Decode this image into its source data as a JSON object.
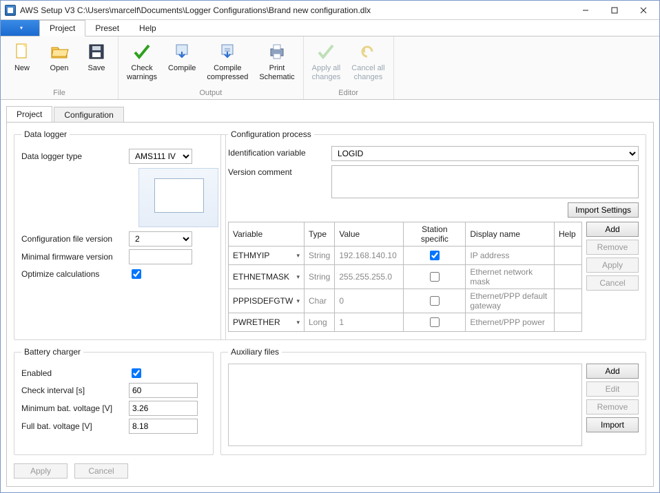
{
  "window": {
    "title": "AWS Setup V3 C:\\Users\\marcelf\\Documents\\Logger Configurations\\Brand new configuration.dlx"
  },
  "menu": {
    "project": "Project",
    "preset": "Preset",
    "help": "Help"
  },
  "ribbon": {
    "file": {
      "label": "File",
      "new": "New",
      "open": "Open",
      "save": "Save"
    },
    "output": {
      "label": "Output",
      "check": "Check\nwarnings",
      "compile": "Compile",
      "compilecomp": "Compile\ncompressed",
      "print": "Print\nSchematic"
    },
    "editor": {
      "label": "Editor",
      "applyall": "Apply all\nchanges",
      "cancelall": "Cancel all\nchanges"
    }
  },
  "page_tabs": {
    "project": "Project",
    "configuration": "Configuration"
  },
  "data_logger": {
    "legend": "Data logger",
    "type_label": "Data logger type",
    "type_value": "AMS111 IV",
    "cfgver_label": "Configuration file version",
    "cfgver_value": "2",
    "minfw_label": "Minimal firmware version",
    "minfw_value": "",
    "optimize_label": "Optimize calculations",
    "optimize_checked": true
  },
  "config_process": {
    "legend": "Configuration process",
    "idvar_label": "Identification variable",
    "idvar_value": "LOGID",
    "vercomment_label": "Version comment",
    "vercomment_value": "",
    "import_settings": "Import Settings",
    "columns": {
      "variable": "Variable",
      "type": "Type",
      "value": "Value",
      "station": "Station specific",
      "display": "Display name",
      "help": "Help"
    },
    "rows": [
      {
        "variable": "ETHMYIP",
        "type": "String",
        "value": "192.168.140.10",
        "station": true,
        "display": "IP address",
        "help": ""
      },
      {
        "variable": "ETHNETMASK",
        "type": "String",
        "value": "255.255.255.0",
        "station": false,
        "display": "Ethernet network mask",
        "help": ""
      },
      {
        "variable": "PPPISDEFGTW",
        "type": "Char",
        "value": "0",
        "station": false,
        "display": "Ethernet/PPP default gateway",
        "help": ""
      },
      {
        "variable": "PWRETHER",
        "type": "Long",
        "value": "1",
        "station": false,
        "display": "Ethernet/PPP power",
        "help": ""
      }
    ],
    "buttons": {
      "add": "Add",
      "remove": "Remove",
      "apply": "Apply",
      "cancel": "Cancel"
    }
  },
  "battery": {
    "legend": "Battery charger",
    "enabled_label": "Enabled",
    "enabled": true,
    "check_label": "Check interval [s]",
    "check_value": "60",
    "min_label": "Minimum bat. voltage [V]",
    "min_value": "3.26",
    "full_label": "Full bat. voltage [V]",
    "full_value": "8.18"
  },
  "aux": {
    "legend": "Auxiliary files",
    "buttons": {
      "add": "Add",
      "edit": "Edit",
      "remove": "Remove",
      "import": "Import"
    }
  },
  "footer": {
    "apply": "Apply",
    "cancel": "Cancel"
  }
}
